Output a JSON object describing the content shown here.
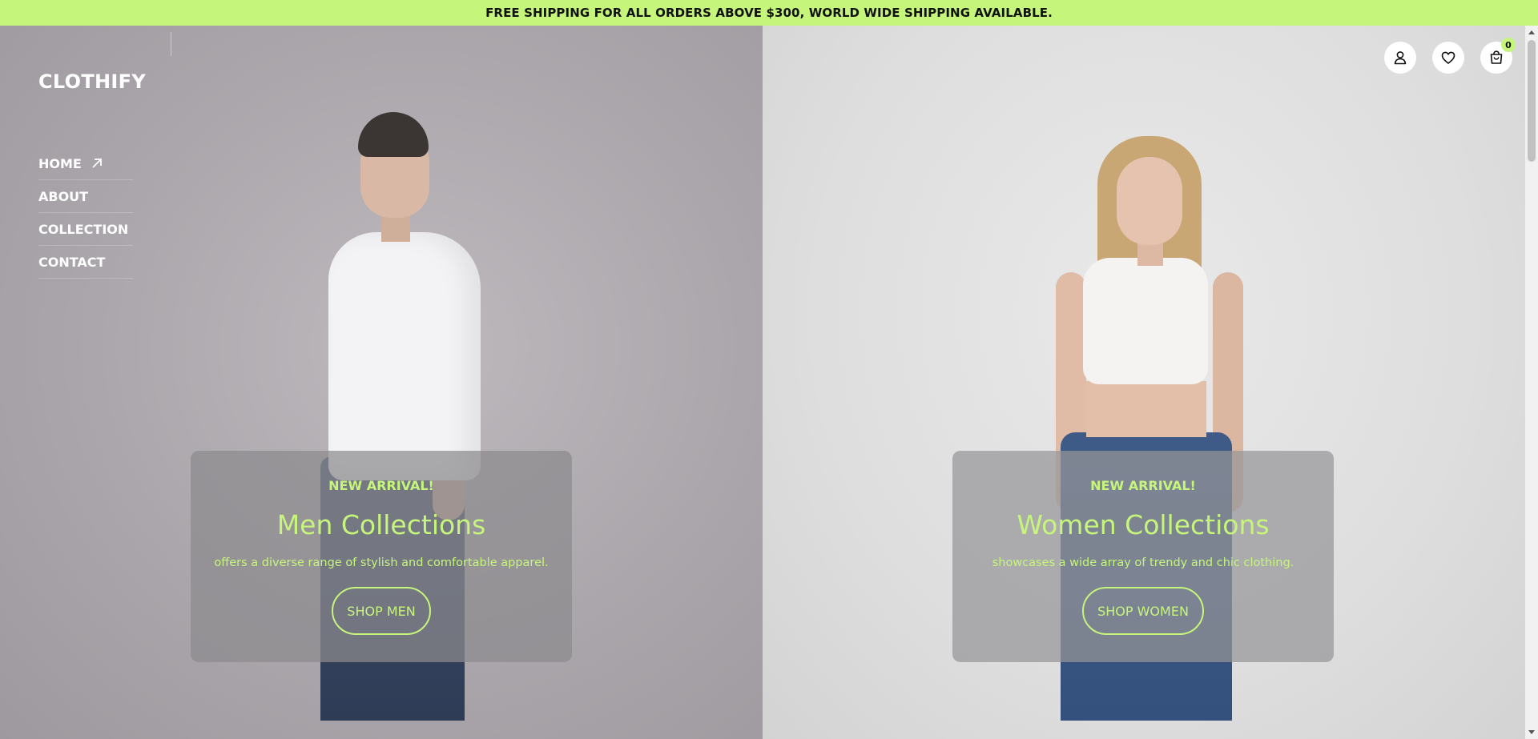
{
  "announcement": "FREE SHIPPING FOR ALL ORDERS ABOVE $300, WORLD WIDE SHIPPING AVAILABLE.",
  "brand": "CLOTHIFY",
  "nav": {
    "items": [
      {
        "label": "HOME",
        "icon": "arrow-up-right-icon"
      },
      {
        "label": "ABOUT"
      },
      {
        "label": "COLLECTION"
      },
      {
        "label": "CONTACT"
      }
    ]
  },
  "header_icons": {
    "account": "user-icon",
    "wishlist": "heart-icon",
    "cart": "shopping-bag-icon",
    "cart_count": "0"
  },
  "men": {
    "eyebrow": "NEW ARRIVAL!",
    "title": "Men Collections",
    "description": "offers a diverse range of stylish and comfortable apparel.",
    "button": "SHOP MEN"
  },
  "women": {
    "eyebrow": "NEW ARRIVAL!",
    "title": "Women Collections",
    "description": "showcases a wide array of trendy and chic clothing.",
    "button": "SHOP WOMEN"
  },
  "colors": {
    "accent": "#c6f57c",
    "men_bg": "#aaa6ab",
    "women_bg": "#dedede"
  }
}
